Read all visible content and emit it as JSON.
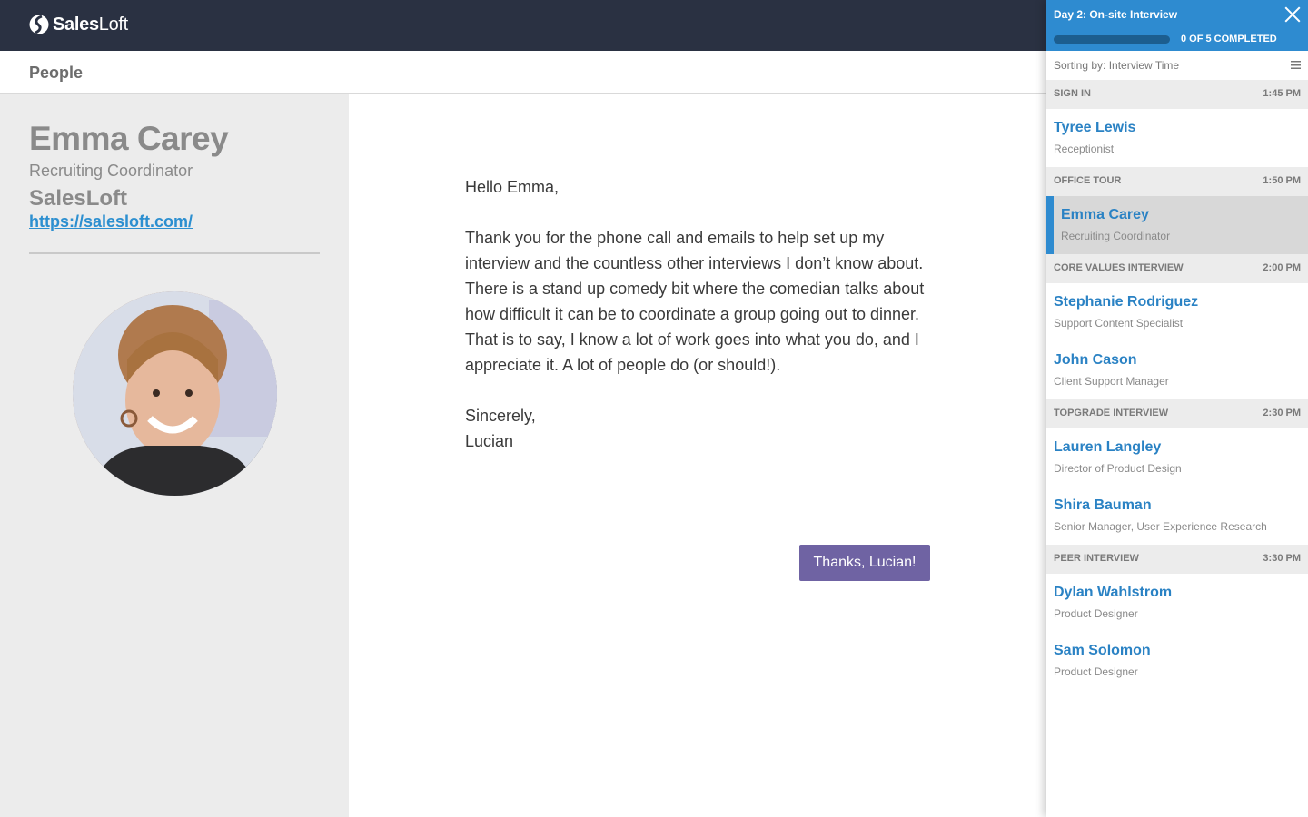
{
  "topbar": {
    "brand_bold": "Sales",
    "brand_light": "Loft"
  },
  "subheader": {
    "title": "People"
  },
  "profile": {
    "name": "Emma Carey",
    "title": "Recruiting Coordinator",
    "company": "SalesLoft",
    "url": "https://salesloft.com/"
  },
  "letter": {
    "greeting": "Hello Emma,",
    "body": "Thank you for the phone call and emails to help set up my interview and the countless other interviews I don’t know about. There is a stand up comedy bit where the comedian talks about how difficult it can be to coordinate a group going out to dinner. That is to say, I know a lot of work goes into what you do, and I appreciate it. A lot of people do (or should!).",
    "closing": "Sincerely,",
    "signature": "Lucian",
    "button_label": "Thanks, Lucian!"
  },
  "panel": {
    "title": "Day 2: On-site Interview",
    "progress_text": "0 OF 5 COMPLETED",
    "progress_fraction": 0,
    "sort_text": "Sorting by: Interview Time",
    "sections": [
      {
        "label": "Sign In",
        "time": "1:45 PM",
        "people": [
          {
            "name": "Tyree Lewis",
            "role": "Receptionist"
          }
        ]
      },
      {
        "label": "Office Tour",
        "time": "1:50 PM",
        "people": [
          {
            "name": "Emma Carey",
            "role": "Recruiting Coordinator",
            "active": true
          }
        ]
      },
      {
        "label": "Core Values Interview",
        "time": "2:00 PM",
        "people": [
          {
            "name": "Stephanie Rodriguez",
            "role": "Support Content Specialist"
          },
          {
            "name": "John Cason",
            "role": "Client Support Manager"
          }
        ]
      },
      {
        "label": "Topgrade Interview",
        "time": "2:30 PM",
        "people": [
          {
            "name": "Lauren Langley",
            "role": "Director of Product Design"
          },
          {
            "name": "Shira Bauman",
            "role": "Senior Manager, User Experience Research"
          }
        ]
      },
      {
        "label": "Peer Interview",
        "time": "3:30 PM",
        "people": [
          {
            "name": "Dylan Wahlstrom",
            "role": "Product Designer"
          },
          {
            "name": "Sam Solomon",
            "role": "Product Designer"
          }
        ]
      }
    ]
  }
}
